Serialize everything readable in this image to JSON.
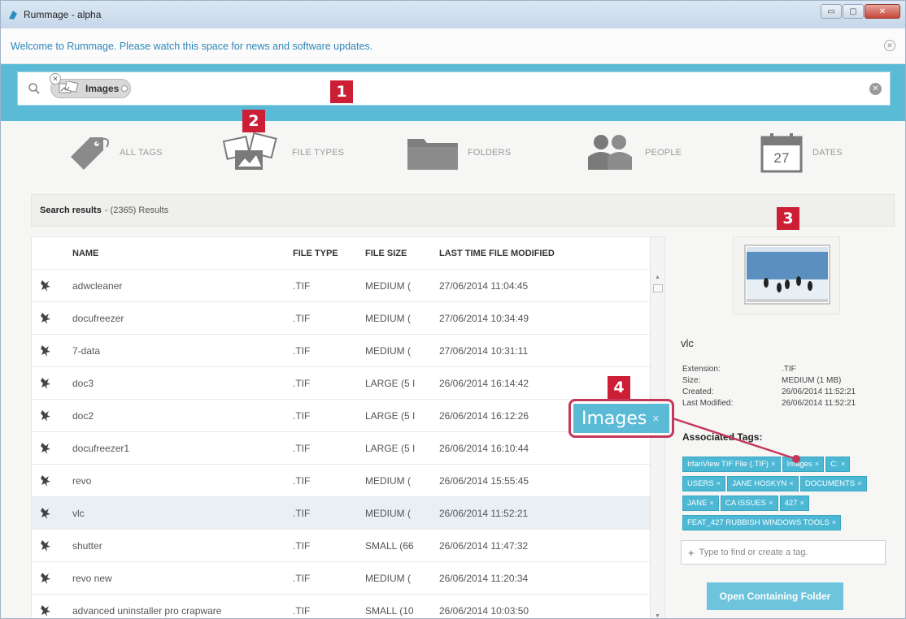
{
  "window": {
    "title": "Rummage - alpha",
    "controls": [
      "▭",
      "▢",
      "✕"
    ]
  },
  "news": {
    "message": "Welcome to Rummage. Please watch this space for news and software updates."
  },
  "search": {
    "chip_label": "Images",
    "placeholder": ""
  },
  "callouts": [
    "1",
    "2",
    "3",
    "4"
  ],
  "filters": [
    {
      "label": "ALL TAGS",
      "icon": "tag-icon"
    },
    {
      "label": "FILE TYPES",
      "icon": "images-icon"
    },
    {
      "label": "FOLDERS",
      "icon": "folder-icon"
    },
    {
      "label": "PEOPLE",
      "icon": "people-icon"
    },
    {
      "label": "DATES",
      "icon": "calendar-icon",
      "day": "27"
    }
  ],
  "results": {
    "title": "Search results",
    "count": "- (2365) Results"
  },
  "table": {
    "columns": [
      "NAME",
      "FILE TYPE",
      "FILE SIZE",
      "LAST TIME FILE MODIFIED"
    ],
    "rows": [
      {
        "name": "adwcleaner",
        "type": ".TIF",
        "size": "MEDIUM (",
        "modified": "27/06/2014 11:04:45"
      },
      {
        "name": "docufreezer",
        "type": ".TIF",
        "size": "MEDIUM (",
        "modified": "27/06/2014 10:34:49"
      },
      {
        "name": "7-data",
        "type": ".TIF",
        "size": "MEDIUM (",
        "modified": "27/06/2014 10:31:11"
      },
      {
        "name": "doc3",
        "type": ".TIF",
        "size": "LARGE (5 I",
        "modified": "26/06/2014 16:14:42"
      },
      {
        "name": "doc2",
        "type": ".TIF",
        "size": "LARGE (5 I",
        "modified": "26/06/2014 16:12:26"
      },
      {
        "name": "docufreezer1",
        "type": ".TIF",
        "size": "LARGE (5 I",
        "modified": "26/06/2014 16:10:44"
      },
      {
        "name": "revo",
        "type": ".TIF",
        "size": "MEDIUM (",
        "modified": "26/06/2014 15:55:45"
      },
      {
        "name": "vlc",
        "type": ".TIF",
        "size": "MEDIUM (",
        "modified": "26/06/2014 11:52:21",
        "selected": true
      },
      {
        "name": "shutter",
        "type": ".TIF",
        "size": "SMALL (66",
        "modified": "26/06/2014 11:47:32"
      },
      {
        "name": "revo new",
        "type": ".TIF",
        "size": "MEDIUM (",
        "modified": "26/06/2014 11:20:34"
      },
      {
        "name": "advanced uninstaller pro crapware",
        "type": ".TIF",
        "size": "SMALL (10",
        "modified": "26/06/2014 10:03:50"
      }
    ]
  },
  "details": {
    "name": "vlc",
    "fields": [
      {
        "key": "Extension:",
        "value": ".TIF"
      },
      {
        "key": "Size:",
        "value": "MEDIUM (1 MB)"
      },
      {
        "key": "Created:",
        "value": "26/06/2014 11:52:21"
      },
      {
        "key": "Last Modified:",
        "value": "26/06/2014 11:52:21"
      }
    ],
    "assoc_title": "Associated Tags:",
    "tags": [
      "IrfanView TIF File (.TIF)",
      "Images",
      "C:",
      "USERS",
      "JANE HOSKYN",
      "DOCUMENTS",
      "JANE",
      "CA ISSUES",
      "427",
      "FEAT_427 RUBBISH WINDOWS TOOLS"
    ],
    "tag_remove": "×",
    "tag_input_placeholder": "Type to find or create a tag.",
    "open_button": "Open Containing Folder"
  },
  "drag_tag": {
    "label": "Images",
    "remove": "×"
  },
  "colors": {
    "accent": "#5bbbd6",
    "callout": "#cc1f36",
    "drag_border": "#c4385a"
  }
}
